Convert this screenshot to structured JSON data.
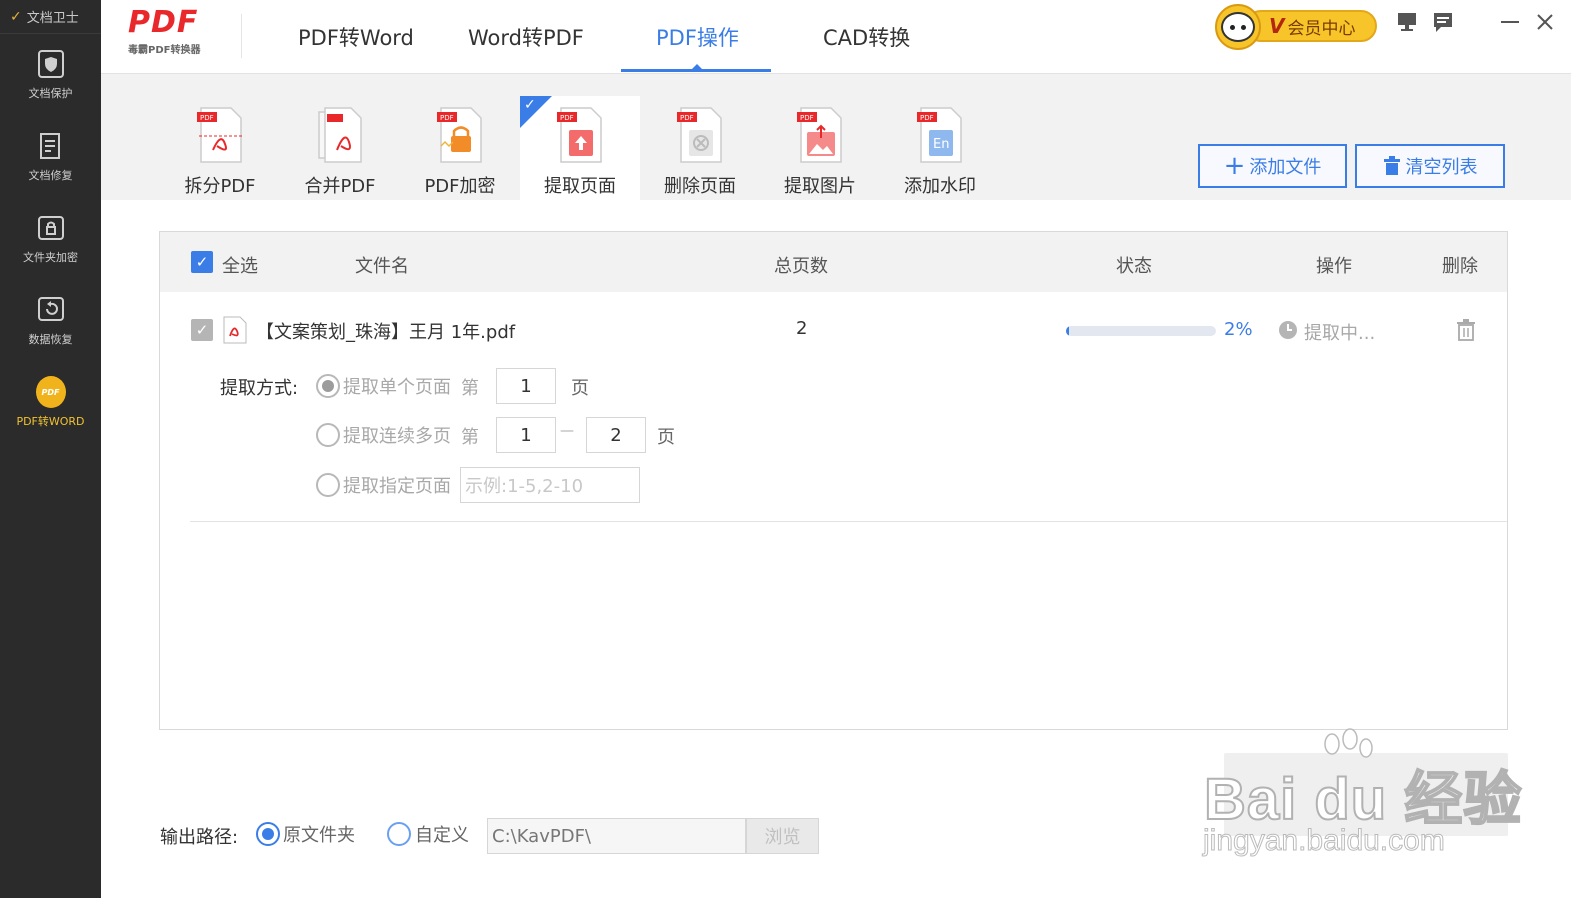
{
  "app": {
    "sidebar_title": "文档卫士",
    "brand_logo": "PDF",
    "brand_sub": "毒霸PDF转换器"
  },
  "sidebar": {
    "items": [
      {
        "label": "文档保护",
        "icon": "shield-icon"
      },
      {
        "label": "文档修复",
        "icon": "document-repair-icon"
      },
      {
        "label": "文件夹加密",
        "icon": "folder-lock-icon"
      },
      {
        "label": "数据恢复",
        "icon": "data-recovery-icon"
      },
      {
        "label": "PDF转WORD",
        "icon": "pdf-convert-icon",
        "icon_text": "PDF",
        "active": true
      }
    ]
  },
  "nav": {
    "tabs": [
      {
        "label": "PDF转Word"
      },
      {
        "label": "Word转PDF"
      },
      {
        "label": "PDF操作",
        "active": true
      },
      {
        "label": "CAD转换"
      }
    ]
  },
  "member": {
    "badge": "V",
    "label": "会员中心"
  },
  "window_controls": [
    "feedback-icon",
    "message-icon",
    "minimize-icon",
    "close-icon"
  ],
  "toolbar": {
    "tools": [
      {
        "label": "拆分PDF",
        "icon": "split-pdf-icon"
      },
      {
        "label": "合并PDF",
        "icon": "merge-pdf-icon"
      },
      {
        "label": "PDF加密",
        "icon": "encrypt-pdf-icon"
      },
      {
        "label": "提取页面",
        "icon": "extract-page-icon",
        "active": true
      },
      {
        "label": "删除页面",
        "icon": "delete-page-icon"
      },
      {
        "label": "提取图片",
        "icon": "extract-image-icon"
      },
      {
        "label": "添加水印",
        "icon": "watermark-icon"
      }
    ],
    "add_file": "添加文件",
    "clear_list": "清空列表"
  },
  "table": {
    "headers": {
      "select_all": "全选",
      "filename": "文件名",
      "pages": "总页数",
      "status": "状态",
      "action": "操作",
      "delete": "删除"
    },
    "rows": [
      {
        "filename": "【文案策划_珠海】王月 1年.pdf",
        "pages": "2",
        "progress_percent": 2,
        "progress_label": "2%",
        "action_label": "提取中...",
        "extract": {
          "mode_label": "提取方式:",
          "single_label": "提取单个页面",
          "range_label": "提取连续多页",
          "custom_label": "提取指定页面",
          "di": "第",
          "page": "页",
          "single_value": "1",
          "range_from": "1",
          "range_to": "2",
          "range_sep": "—",
          "custom_placeholder": "示例:1-5,2-10",
          "selected": "single"
        }
      }
    ]
  },
  "output": {
    "label": "输出路径:",
    "option_original": "原文件夹",
    "option_custom": "自定义",
    "selected": "original",
    "path": "C:\\KavPDF\\",
    "browse": "浏览"
  },
  "watermark": {
    "brand": "Bai du 经验",
    "url": "jingyan.baidu.com"
  },
  "colors": {
    "accent": "#3b7de6",
    "sidebar_bg": "#2b2b2b",
    "brand_red": "#e8282a",
    "member_gold": "#f7c52a"
  }
}
